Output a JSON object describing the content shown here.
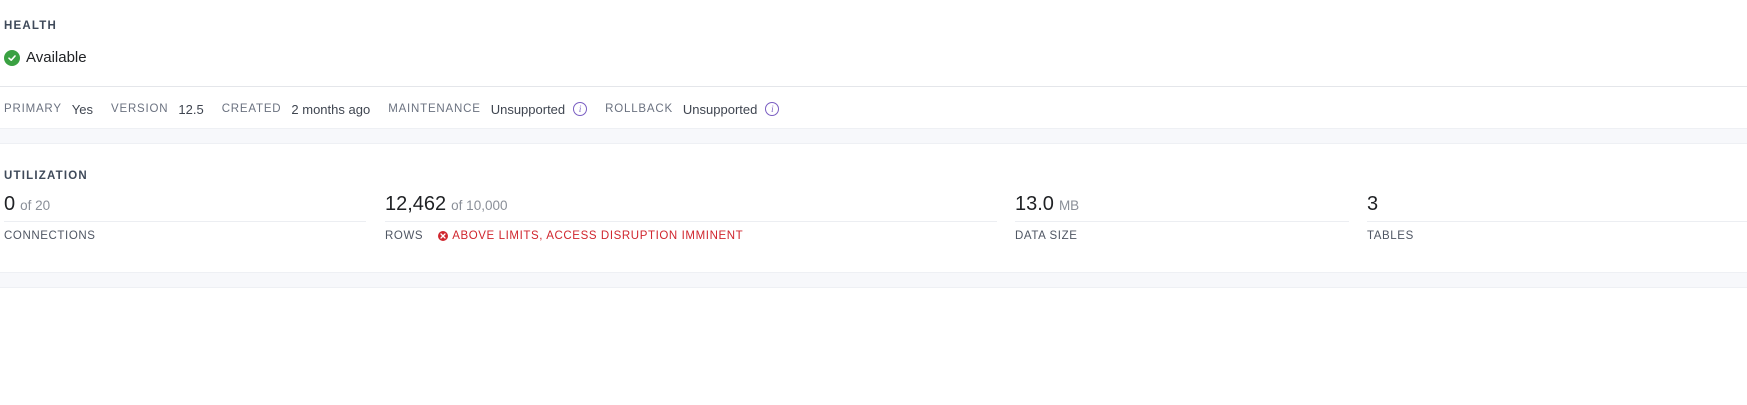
{
  "health": {
    "title": "HEALTH",
    "status": "Available",
    "status_icon": "check-circle-icon",
    "status_color": "#3aa142"
  },
  "meta": {
    "primary_label": "PRIMARY",
    "primary_value": "Yes",
    "version_label": "VERSION",
    "version_value": "12.5",
    "created_label": "CREATED",
    "created_value": "2 months ago",
    "maintenance_label": "MAINTENANCE",
    "maintenance_value": "Unsupported",
    "rollback_label": "ROLLBACK",
    "rollback_value": "Unsupported",
    "info_icon": "info-icon",
    "info_glyph": "i",
    "info_color": "#7a5ec2"
  },
  "utilization": {
    "title": "UTILIZATION",
    "connections": {
      "value": "0",
      "sub": "of 20",
      "label": "CONNECTIONS"
    },
    "rows": {
      "value": "12,462",
      "sub": "of 10,000",
      "label": "ROWS",
      "warning": "ABOVE LIMITS, ACCESS DISRUPTION IMMINENT",
      "warning_icon": "x-circle-icon",
      "warning_color": "#d0262e"
    },
    "data_size": {
      "value": "13.0",
      "sub": "MB",
      "label": "DATA SIZE"
    },
    "tables": {
      "value": "3",
      "label": "TABLES"
    }
  }
}
